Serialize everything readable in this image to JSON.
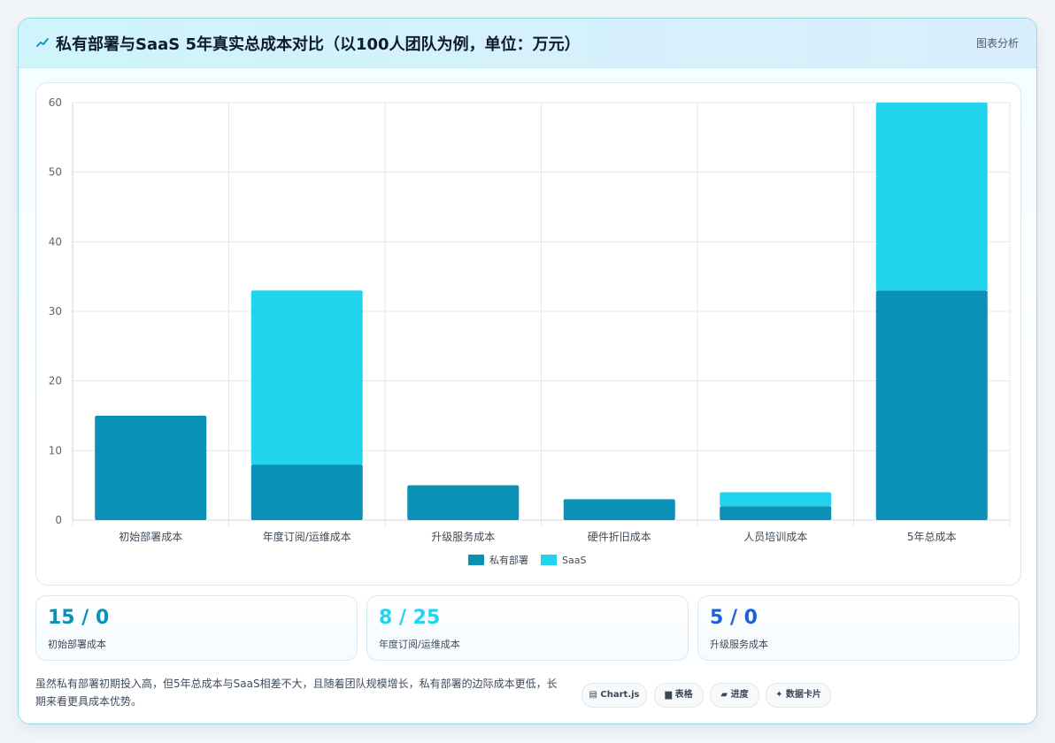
{
  "header": {
    "title": "私有部署与SaaS 5年真实总成本对比（以100人团队为例，单位：万元）",
    "tag": "图表分析"
  },
  "chart_data": {
    "type": "bar",
    "stacked": true,
    "categories": [
      "初始部署成本",
      "年度订阅/运维成本",
      "升级服务成本",
      "硬件折旧成本",
      "人员培训成本",
      "5年总成本"
    ],
    "series": [
      {
        "name": "私有部署",
        "values": [
          15,
          8,
          5,
          3,
          2,
          33
        ],
        "color": "#0a91b5"
      },
      {
        "name": "SaaS",
        "values": [
          0,
          25,
          0,
          0,
          2,
          27
        ],
        "color": "#22d3ee"
      }
    ],
    "ylim": [
      0,
      60
    ],
    "yticks": [
      0,
      10,
      20,
      30,
      40,
      50,
      60
    ],
    "grid": true,
    "legend": "bottom"
  },
  "stats": [
    {
      "value": "15 / 0",
      "label": "初始部署成本",
      "color": "#0a91b5"
    },
    {
      "value": "8 / 25",
      "label": "年度订阅/运维成本",
      "color": "#22d3ee"
    },
    {
      "value": "5 / 0",
      "label": "升级服务成本",
      "color": "#1d5fd8"
    }
  ],
  "footer": {
    "text": "虽然私有部署初期投入高，但5年总成本与SaaS相差不大，且随着团队规模增长，私有部署的边际成本更低，长期来看更具成本优势。",
    "pills": [
      "▤ Chart.js",
      "▆ 表格",
      "▰ 进度",
      "✦ 数据卡片"
    ]
  }
}
